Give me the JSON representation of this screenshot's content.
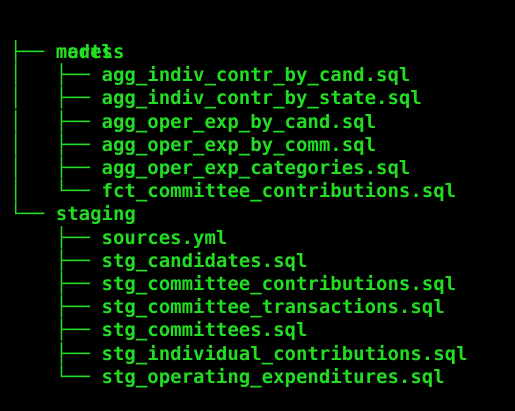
{
  "tree": {
    "root": "models",
    "lines": [
      {
        "prefix": "├── ",
        "name": "marts",
        "kind": "dir"
      },
      {
        "prefix": "│   ├── ",
        "name": "agg_indiv_contr_by_cand.sql",
        "kind": "file"
      },
      {
        "prefix": "│   ├── ",
        "name": "agg_indiv_contr_by_state.sql",
        "kind": "file"
      },
      {
        "prefix": "│   ├── ",
        "name": "agg_oper_exp_by_cand.sql",
        "kind": "file"
      },
      {
        "prefix": "│   ├── ",
        "name": "agg_oper_exp_by_comm.sql",
        "kind": "file"
      },
      {
        "prefix": "│   ├── ",
        "name": "agg_oper_exp_categories.sql",
        "kind": "file"
      },
      {
        "prefix": "│   └── ",
        "name": "fct_committee_contributions.sql",
        "kind": "file"
      },
      {
        "prefix": "└── ",
        "name": "staging",
        "kind": "dir"
      },
      {
        "prefix": "    ├── ",
        "name": "sources.yml",
        "kind": "file"
      },
      {
        "prefix": "    ├── ",
        "name": "stg_candidates.sql",
        "kind": "file"
      },
      {
        "prefix": "    ├── ",
        "name": "stg_committee_contributions.sql",
        "kind": "file"
      },
      {
        "prefix": "    ├── ",
        "name": "stg_committee_transactions.sql",
        "kind": "file"
      },
      {
        "prefix": "    ├── ",
        "name": "stg_committees.sql",
        "kind": "file"
      },
      {
        "prefix": "    ├── ",
        "name": "stg_individual_contributions.sql",
        "kind": "file"
      },
      {
        "prefix": "    └── ",
        "name": "stg_operating_expenditures.sql",
        "kind": "file"
      }
    ]
  },
  "colors": {
    "background": "#000000",
    "text": "#22dd22"
  }
}
